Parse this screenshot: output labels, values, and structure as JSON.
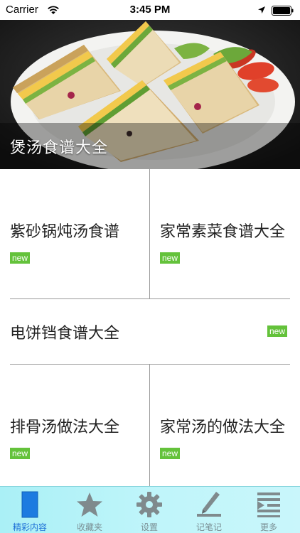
{
  "status_bar": {
    "carrier": "Carrier",
    "time": "3:45 PM"
  },
  "hero": {
    "title": "煲汤食谱大全"
  },
  "cells": [
    {
      "title": "紫砂锅炖汤食谱",
      "badge": "new"
    },
    {
      "title": "家常素菜食谱大全",
      "badge": "new"
    },
    {
      "title": "电饼铛食谱大全",
      "badge": "new"
    },
    {
      "title": "排骨汤做法大全",
      "badge": "new"
    },
    {
      "title": "家常汤的做法大全",
      "badge": "new"
    }
  ],
  "tabs": [
    {
      "label": "精彩内容",
      "icon": "document-icon",
      "active": true
    },
    {
      "label": "收藏夹",
      "icon": "star-icon",
      "active": false
    },
    {
      "label": "设置",
      "icon": "gear-icon",
      "active": false
    },
    {
      "label": "记笔记",
      "icon": "pen-icon",
      "active": false
    },
    {
      "label": "更多",
      "icon": "menu-icon",
      "active": false
    }
  ],
  "colors": {
    "badge": "#64c23b",
    "tab_active": "#1d6fd6",
    "tab_inactive": "#7a8f94",
    "tab_bar": "#bff5fa"
  }
}
